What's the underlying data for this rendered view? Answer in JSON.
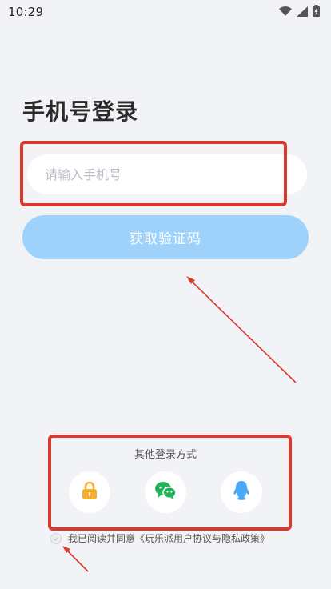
{
  "status_bar": {
    "time": "10:29"
  },
  "page_title": "手机号登录",
  "phone_input": {
    "placeholder": "请输入手机号",
    "value": ""
  },
  "get_code_button": {
    "label": "获取验证码"
  },
  "other_login": {
    "label": "其他登录方式",
    "options": [
      {
        "icon": "lock-icon",
        "color": "#f5b02e"
      },
      {
        "icon": "wechat-icon",
        "color": "#22b35a"
      },
      {
        "icon": "qq-icon",
        "color": "#4aa8f5"
      }
    ]
  },
  "agreement": {
    "text": "我已阅读并同意《玩乐派用户协议与隐私政策》",
    "checked": false
  },
  "colors": {
    "background": "#f2f3f7",
    "button": "#9fd2fb",
    "annotation": "#d93a2b"
  }
}
